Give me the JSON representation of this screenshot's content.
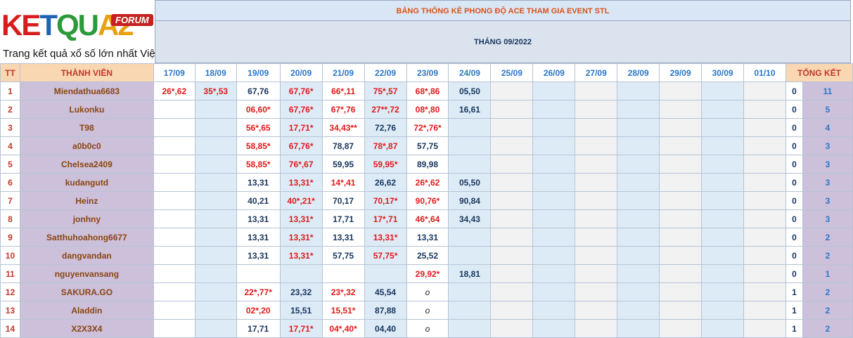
{
  "logo": {
    "part1": "KE",
    "part2": "T",
    "part3": "QU",
    "part4": "A2",
    "forum": "FORUM",
    "tagline": "Trang kết quả xổ số lớn nhất Việt Nam"
  },
  "title": "BẢNG THỐNG KÊ PHONG ĐỘ ACE THAM GIA EVENT STL",
  "month": "THÁNG 09/2022",
  "headers": {
    "tt": "TT",
    "name": "THÀNH VIÊN",
    "total": "TỔNG KẾT"
  },
  "dates": [
    "17/09",
    "18/09",
    "19/09",
    "20/09",
    "21/09",
    "22/09",
    "23/09",
    "24/09",
    "25/09",
    "26/09",
    "27/09",
    "28/09",
    "29/09",
    "30/09",
    "01/10"
  ],
  "rows": [
    {
      "tt": "1",
      "name": "Miendathua6683",
      "cells": [
        "26*,62",
        "35*,53",
        "67,76",
        "67,76*",
        "66*,11",
        "75*,57",
        "68*,86",
        "05,50",
        "",
        "",
        "",
        "",
        "",
        "",
        ""
      ],
      "sub": "0",
      "total": "11"
    },
    {
      "tt": "2",
      "name": "Lukonku",
      "cells": [
        "",
        "",
        "06,60*",
        "67,76*",
        "67*,76",
        "27**,72",
        "08*,80",
        "16,61",
        "",
        "",
        "",
        "",
        "",
        "",
        ""
      ],
      "sub": "0",
      "total": "5"
    },
    {
      "tt": "3",
      "name": "T98",
      "cells": [
        "",
        "",
        "56*,65",
        "17,71*",
        "34,43**",
        "72,76",
        "72*,76*",
        "",
        "",
        "",
        "",
        "",
        "",
        "",
        ""
      ],
      "sub": "0",
      "total": "4"
    },
    {
      "tt": "4",
      "name": "a0b0c0",
      "cells": [
        "",
        "",
        "58,85*",
        "67,76*",
        "78,87",
        "78*,87",
        "57,75",
        "",
        "",
        "",
        "",
        "",
        "",
        "",
        ""
      ],
      "sub": "0",
      "total": "3"
    },
    {
      "tt": "5",
      "name": "Chelsea2409",
      "cells": [
        "",
        "",
        "58,85*",
        "76*,67",
        "59,95",
        "59,95*",
        "89,98",
        "",
        "",
        "",
        "",
        "",
        "",
        "",
        ""
      ],
      "sub": "0",
      "total": "3"
    },
    {
      "tt": "6",
      "name": "kudangutd",
      "cells": [
        "",
        "",
        "13,31",
        "13,31*",
        "14*,41",
        "26,62",
        "26*,62",
        "05,50",
        "",
        "",
        "",
        "",
        "",
        "",
        ""
      ],
      "sub": "0",
      "total": "3"
    },
    {
      "tt": "7",
      "name": "Heinz",
      "cells": [
        "",
        "",
        "40,21",
        "40*,21*",
        "70,17",
        "70,17*",
        "90,76*",
        "90,84",
        "",
        "",
        "",
        "",
        "",
        "",
        ""
      ],
      "sub": "0",
      "total": "3"
    },
    {
      "tt": "8",
      "name": "jonhny",
      "cells": [
        "",
        "",
        "13,31",
        "13,31*",
        "17,71",
        "17*,71",
        "46*,64",
        "34,43",
        "",
        "",
        "",
        "",
        "",
        "",
        ""
      ],
      "sub": "0",
      "total": "3"
    },
    {
      "tt": "9",
      "name": "Satthuhoahong6677",
      "cells": [
        "",
        "",
        "13,31",
        "13,31*",
        "13,31",
        "13,31*",
        "13,31",
        "",
        "",
        "",
        "",
        "",
        "",
        "",
        ""
      ],
      "sub": "0",
      "total": "2"
    },
    {
      "tt": "10",
      "name": "dangvandan",
      "cells": [
        "",
        "",
        "13,31",
        "13,31*",
        "57,75",
        "57,75*",
        "25,52",
        "",
        "",
        "",
        "",
        "",
        "",
        "",
        ""
      ],
      "sub": "0",
      "total": "2"
    },
    {
      "tt": "11",
      "name": "nguyenvansang",
      "cells": [
        "",
        "",
        "",
        "",
        "",
        "",
        "29,92*",
        "18,81",
        "",
        "",
        "",
        "",
        "",
        "",
        ""
      ],
      "sub": "0",
      "total": "1"
    },
    {
      "tt": "12",
      "name": "SAKURA.GO",
      "cells": [
        "",
        "",
        "22*,77*",
        "23,32",
        "23*,32",
        "45,54",
        "o",
        "",
        "",
        "",
        "",
        "",
        "",
        "",
        ""
      ],
      "sub": "1",
      "total": "2"
    },
    {
      "tt": "13",
      "name": "Aladdin",
      "cells": [
        "",
        "",
        "02*,20",
        "15,51",
        "15,51*",
        "87,88",
        "o",
        "",
        "",
        "",
        "",
        "",
        "",
        "",
        ""
      ],
      "sub": "1",
      "total": "2"
    },
    {
      "tt": "14",
      "name": "X2X3X4",
      "cells": [
        "",
        "",
        "17,71",
        "17,71*",
        "04*,40*",
        "04,40",
        "o",
        "",
        "",
        "",
        "",
        "",
        "",
        "",
        ""
      ],
      "sub": "1",
      "total": "2"
    }
  ]
}
